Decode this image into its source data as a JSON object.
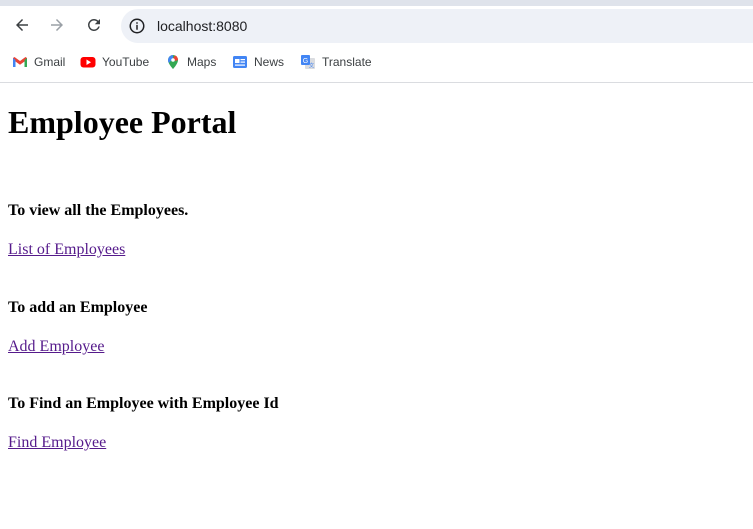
{
  "browser": {
    "url": "localhost:8080",
    "bookmarks": [
      {
        "label": "Gmail",
        "icon": "gmail-icon"
      },
      {
        "label": "YouTube",
        "icon": "youtube-icon"
      },
      {
        "label": "Maps",
        "icon": "maps-icon"
      },
      {
        "label": "News",
        "icon": "news-icon"
      },
      {
        "label": "Translate",
        "icon": "translate-icon"
      }
    ]
  },
  "page": {
    "title": "Employee Portal",
    "sections": [
      {
        "label": "To view all the Employees.",
        "link": "List of Employees"
      },
      {
        "label": "To add an Employee",
        "link": "Add Employee"
      },
      {
        "label": "To Find an Employee with Employee Id",
        "link": "Find Employee"
      }
    ]
  },
  "colors": {
    "visited_link": "#551a8b",
    "omnibox_bg": "#eef1f7"
  }
}
